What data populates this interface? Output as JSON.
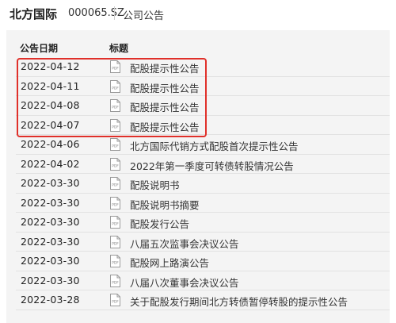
{
  "header": {
    "company_name": "北方国际",
    "stock_code": "000065.SZ",
    "section": "公司公告"
  },
  "table": {
    "columns": {
      "date": "公告日期",
      "title": "标题"
    },
    "pdf_icon_label": "PDF",
    "rows": [
      {
        "date": "2022-04-12",
        "title": "配股提示性公告"
      },
      {
        "date": "2022-04-11",
        "title": "配股提示性公告"
      },
      {
        "date": "2022-04-08",
        "title": "配股提示性公告"
      },
      {
        "date": "2022-04-07",
        "title": "配股提示性公告"
      },
      {
        "date": "2022-04-06",
        "title": "北方国际代销方式配股首次提示性公告"
      },
      {
        "date": "2022-04-02",
        "title": "2022年第一季度可转债转股情况公告"
      },
      {
        "date": "2022-03-30",
        "title": "配股说明书"
      },
      {
        "date": "2022-03-30",
        "title": "配股说明书摘要"
      },
      {
        "date": "2022-03-30",
        "title": "配股发行公告"
      },
      {
        "date": "2022-03-30",
        "title": "八届五次监事会决议公告"
      },
      {
        "date": "2022-03-30",
        "title": "配股网上路演公告"
      },
      {
        "date": "2022-03-30",
        "title": "八届八次董事会决议公告"
      },
      {
        "date": "2022-03-28",
        "title": "关于配股发行期间北方转债暂停转股的提示性公告"
      }
    ]
  },
  "colors": {
    "highlight_border": "#e0302a",
    "panel_background": "#f4f4f4"
  }
}
